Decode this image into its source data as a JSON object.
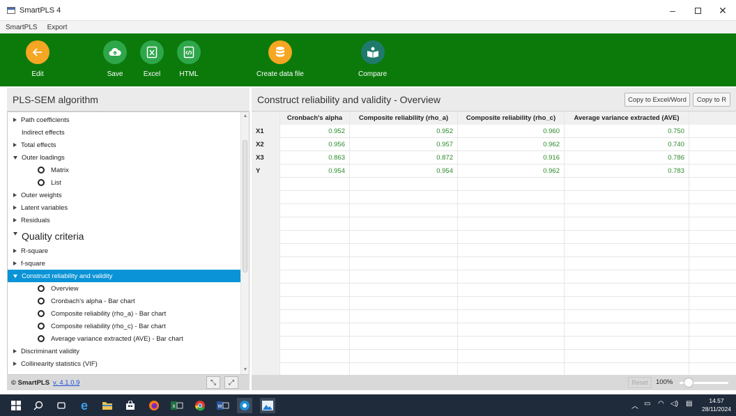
{
  "window": {
    "title": "SmartPLS 4"
  },
  "menu": [
    "SmartPLS",
    "Export"
  ],
  "toolbar": {
    "buttons": [
      {
        "label": "Edit",
        "icon": "back-arrow-icon",
        "color": "#f5a623"
      },
      {
        "label": "Save",
        "icon": "cloud-upload-icon",
        "color": "#2ea64a"
      },
      {
        "label": "Excel",
        "icon": "excel-file-icon",
        "color": "#2ea64a"
      },
      {
        "label": "HTML",
        "icon": "html-file-icon",
        "color": "#2ea64a"
      },
      {
        "label": "Create data file",
        "icon": "database-icon",
        "color": "#f5a623"
      },
      {
        "label": "Compare",
        "icon": "compare-icon",
        "color": "#1f7a6c"
      }
    ]
  },
  "left_panel": {
    "title": "PLS-SEM algorithm",
    "tree": [
      {
        "label": "Path coefficients",
        "type": "collapsed"
      },
      {
        "label": "Indirect effects",
        "type": "leaf"
      },
      {
        "label": "Total effects",
        "type": "collapsed"
      },
      {
        "label": "Outer loadings",
        "type": "expanded"
      },
      {
        "label": "Matrix",
        "type": "radio-big"
      },
      {
        "label": "List",
        "type": "radio-big"
      },
      {
        "label": "Outer weights",
        "type": "collapsed"
      },
      {
        "label": "Latent variables",
        "type": "collapsed"
      },
      {
        "label": "Residuals",
        "type": "collapsed"
      },
      {
        "label": "Quality criteria",
        "type": "group"
      },
      {
        "label": "R-square",
        "type": "collapsed"
      },
      {
        "label": "f-square",
        "type": "collapsed"
      },
      {
        "label": "Construct reliability and validity",
        "type": "expanded-selected"
      },
      {
        "label": "Overview",
        "type": "radio"
      },
      {
        "label": "Cronbach's alpha - Bar chart",
        "type": "radio"
      },
      {
        "label": "Composite reliability (rho_a) - Bar chart",
        "type": "radio"
      },
      {
        "label": "Composite reliability (rho_c) - Bar chart",
        "type": "radio"
      },
      {
        "label": "Average variance extracted (AVE) - Bar chart",
        "type": "radio"
      },
      {
        "label": "Discriminant validity",
        "type": "collapsed"
      },
      {
        "label": "Collinearity statistics (VIF)",
        "type": "collapsed"
      }
    ],
    "footer_copyright": "© SmartPLS",
    "footer_version": "v. 4.1.0.9",
    "collapse_icon": "collapse-icon",
    "expand_icon": "expand-icon"
  },
  "right_panel": {
    "title": "Construct reliability and validity - Overview",
    "copy_excel_label": "Copy to Excel/Word",
    "copy_r_label": "Copy to R",
    "table": {
      "columns": [
        "",
        "Cronbach's alpha",
        "Composite reliability (rho_a)",
        "Composite reliability (rho_c)",
        "Average variance extracted (AVE)"
      ],
      "rows": [
        {
          "name": "X1",
          "values": [
            "0.952",
            "0.952",
            "0.960",
            "0.750"
          ]
        },
        {
          "name": "X2",
          "values": [
            "0.956",
            "0.957",
            "0.962",
            "0.740"
          ]
        },
        {
          "name": "X3",
          "values": [
            "0.863",
            "0.872",
            "0.916",
            "0.786"
          ]
        },
        {
          "name": "Y",
          "values": [
            "0.954",
            "0.954",
            "0.962",
            "0.783"
          ]
        }
      ],
      "value_color": "#2a8a2a"
    },
    "reset_label": "Reset",
    "zoom_label": "100%"
  },
  "taskbar": {
    "icons": [
      "windows-start-icon",
      "search-icon",
      "task-view-icon",
      "edge-icon",
      "file-explorer-icon",
      "store-icon",
      "firefox-icon",
      "excel-icon",
      "chrome-icon",
      "word-icon",
      "smartpls-icon",
      "photos-icon"
    ],
    "time": "14.57",
    "date": "28/11/2024"
  }
}
